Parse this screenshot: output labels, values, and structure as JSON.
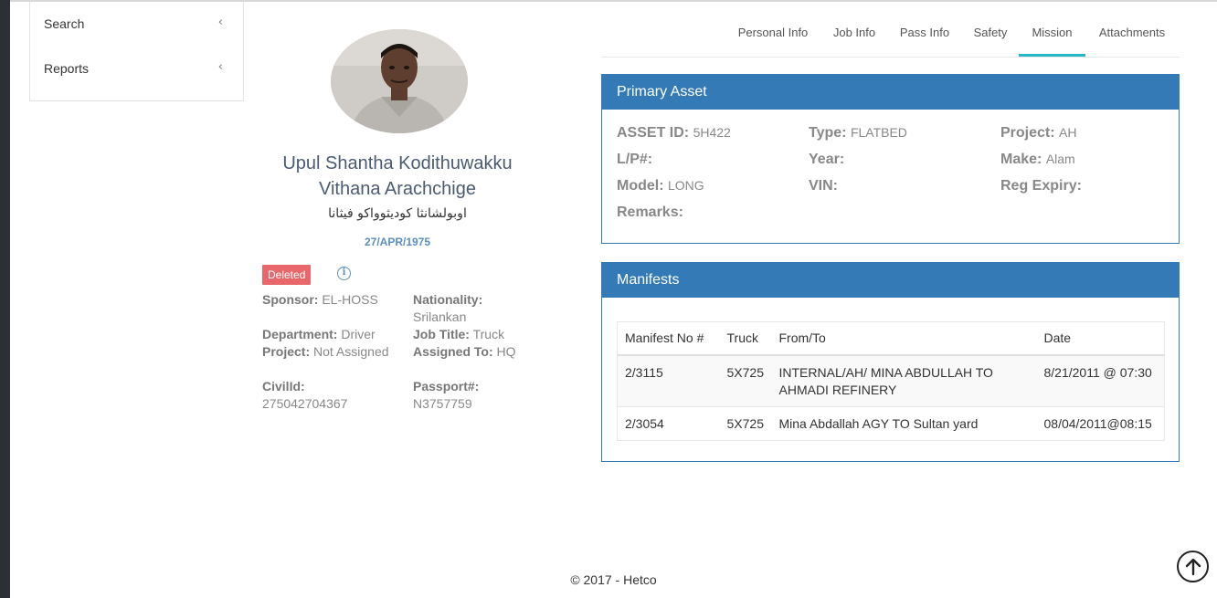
{
  "sidebar": {
    "items": [
      {
        "label": "Search",
        "icon": "chevron-left-icon"
      },
      {
        "label": "Reports",
        "icon": "chevron-left-icon"
      }
    ]
  },
  "profile": {
    "name_line1": "Upul Shantha Kodithuwakku",
    "name_line2": "Vithana Arachchige",
    "arabic_name": "اوبولشانثا كوديثوواكو فيثانا",
    "dob": "27/APR/1975",
    "status_badge": "Deleted",
    "info_icon_glyph": "i",
    "fields": {
      "sponsor_label": "Sponsor:",
      "sponsor_value": "EL-HOSS",
      "nationality_label": "Nationality:",
      "nationality_value": "Srilankan",
      "department_label": "Department:",
      "department_value": "Driver",
      "job_title_label": "Job Title:",
      "job_title_value": "Truck",
      "project_label": "Project:",
      "project_value": "Not Assigned",
      "assigned_to_label": "Assigned To:",
      "assigned_to_value": "HQ",
      "civil_id_label": "CivilId:",
      "civil_id_value": "275042704367",
      "passport_label": "Passport#:",
      "passport_value": "N3757759"
    }
  },
  "tabs": [
    {
      "label": "Personal Info"
    },
    {
      "label": "Job Info"
    },
    {
      "label": "Pass Info"
    },
    {
      "label": "Safety"
    },
    {
      "label": "Mission",
      "active": true
    },
    {
      "label": "Attachments"
    }
  ],
  "primary_asset": {
    "title": "Primary Asset",
    "asset_id_label": "ASSET ID:",
    "asset_id_value": "5H422",
    "type_label": "Type:",
    "type_value": "FLATBED",
    "project_label": "Project:",
    "project_value": "AH",
    "lp_label": "L/P#:",
    "lp_value": "",
    "year_label": "Year:",
    "year_value": "",
    "make_label": "Make:",
    "make_value": "Alam",
    "model_label": "Model:",
    "model_value": "LONG",
    "vin_label": "VIN:",
    "vin_value": "",
    "reg_expiry_label": "Reg Expiry:",
    "reg_expiry_value": "",
    "remarks_label": "Remarks:",
    "remarks_value": ""
  },
  "manifests": {
    "title": "Manifests",
    "headers": [
      "Manifest No #",
      "Truck",
      "From/To",
      "Date"
    ],
    "rows": [
      {
        "manifest_no": "2/3115",
        "truck": "5X725",
        "from_to": "INTERNAL/AH/ MINA ABDULLAH TO AHMADI REFINERY",
        "date": "8/21/2011 @ 07:30"
      },
      {
        "manifest_no": "2/3054",
        "truck": "5X725",
        "from_to": "Mina Abdallah AGY TO Sultan yard",
        "date": "08/04/2011@08:15"
      }
    ]
  },
  "footer": {
    "text": "© 2017 - Hetco"
  },
  "colors": {
    "panel_header": "#337ab7",
    "active_tab": "#26b8c6",
    "deleted_badge": "#e8676b",
    "name": "#4c5a72",
    "dob": "#5b8fc4"
  }
}
